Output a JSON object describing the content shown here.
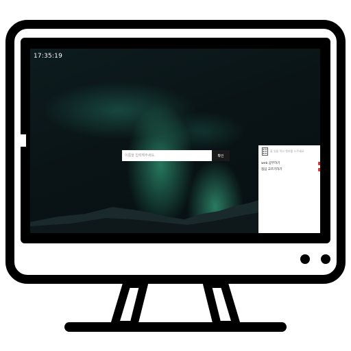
{
  "desktop": {
    "clock": "17:35:19",
    "name_input": {
      "placeholder": "이름을 입력해주세요."
    },
    "confirm_label": "확인"
  },
  "todo": {
    "input_placeholder": "할 일을 적고 엔터를 누르세요",
    "items": [
      {
        "label": "web 공부하기"
      },
      {
        "label": "점심 고르기하기"
      }
    ]
  },
  "colors": {
    "aurora": "#3cc896",
    "delete": "#d33333",
    "screen_bg": "#0a1416"
  }
}
